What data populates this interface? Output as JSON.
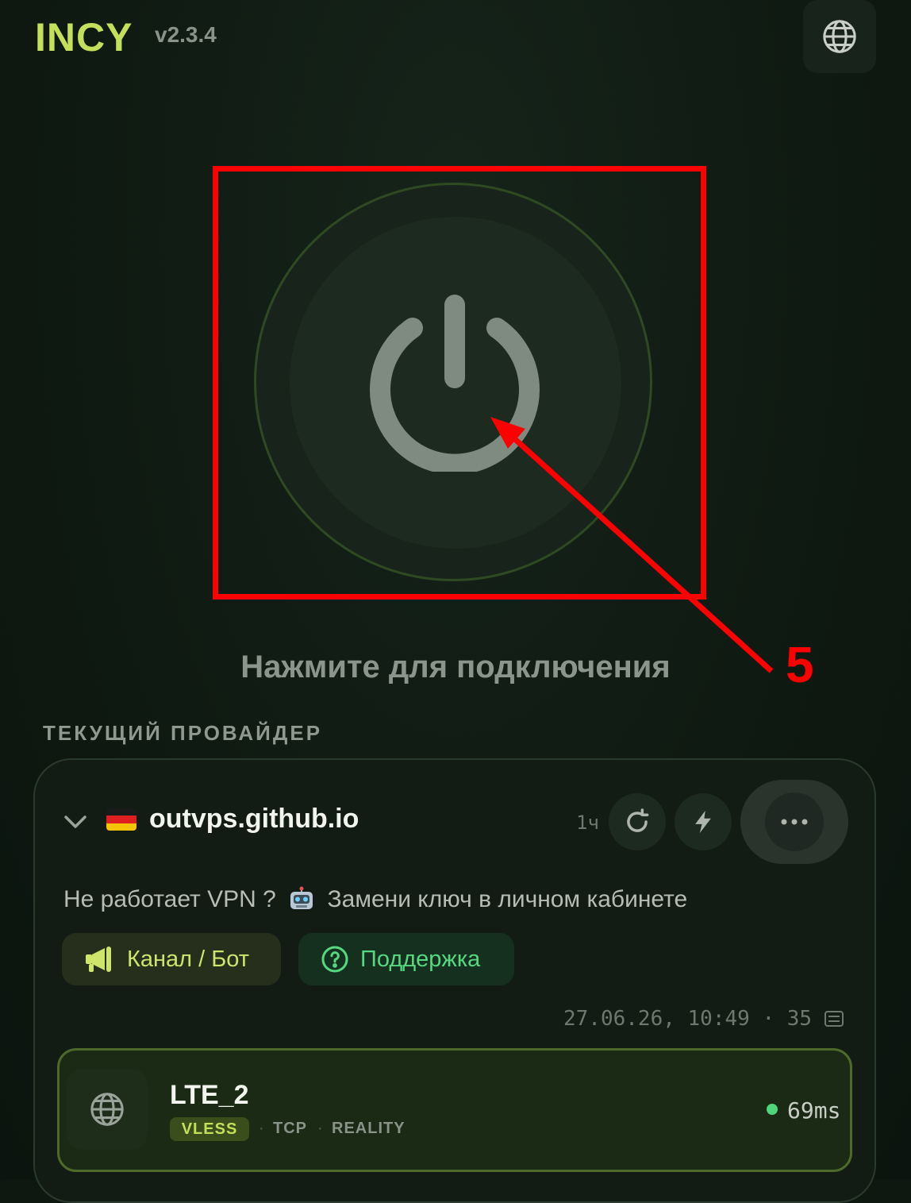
{
  "header": {
    "brand": "INCY",
    "version": "v2.3.4",
    "language_icon": "globe-icon"
  },
  "power": {
    "hint": "Нажмите для подключения",
    "icon": "power-icon"
  },
  "annotation": {
    "number": "5",
    "color": "#ff0000"
  },
  "provider": {
    "section_title": "ТЕКУЩИЙ ПРОВАЙДЕР",
    "flag": "germany-flag",
    "name": "outvps.github.io",
    "age": "1ч",
    "message_before": "Не работает VPN ?",
    "message_after": "Замени ключ в личном кабинете",
    "channel_label": "Канал / Бот",
    "support_label": "Поддержка",
    "updated": "27.06.26, 10:49",
    "server_count": "35"
  },
  "server": {
    "name": "LTE_2",
    "protocol": "VLESS",
    "transport": "TCP",
    "security": "REALITY",
    "ping": "69ms"
  },
  "colors": {
    "accent": "#c4df5a",
    "support": "#55d880",
    "online": "#4fd67a"
  }
}
